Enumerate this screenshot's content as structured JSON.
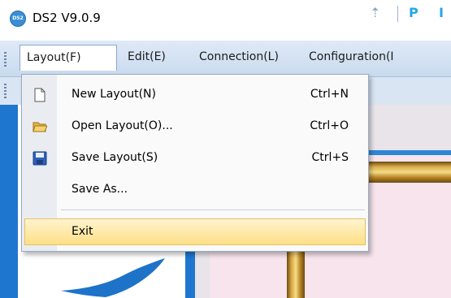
{
  "window": {
    "title": "DS2 V9.0.9",
    "icon_text": "DS2"
  },
  "menubar": {
    "items": [
      "Layout(F)",
      "Edit(E)",
      "Connection(L)",
      "Configuration(I"
    ]
  },
  "toolbar": {
    "p_label": "P",
    "i_label": "I"
  },
  "dropdown": {
    "items": [
      {
        "label": "New Layout(N)",
        "shortcut": "Ctrl+N",
        "icon": "new-document-icon"
      },
      {
        "label": "Open Layout(O)...",
        "shortcut": "Ctrl+O",
        "icon": "open-folder-icon"
      },
      {
        "label": "Save Layout(S)",
        "shortcut": "Ctrl+S",
        "icon": "save-disk-icon"
      },
      {
        "label": "Save As...",
        "shortcut": "",
        "icon": ""
      },
      {
        "label": "Exit",
        "shortcut": "",
        "icon": ""
      }
    ],
    "highlighted_item": "Exit"
  },
  "colors": {
    "menubar": "#c9daee",
    "highlight": "#fddf86",
    "panel_blue": "#1f76cf",
    "toolbar_accent": "#23a7e0"
  }
}
